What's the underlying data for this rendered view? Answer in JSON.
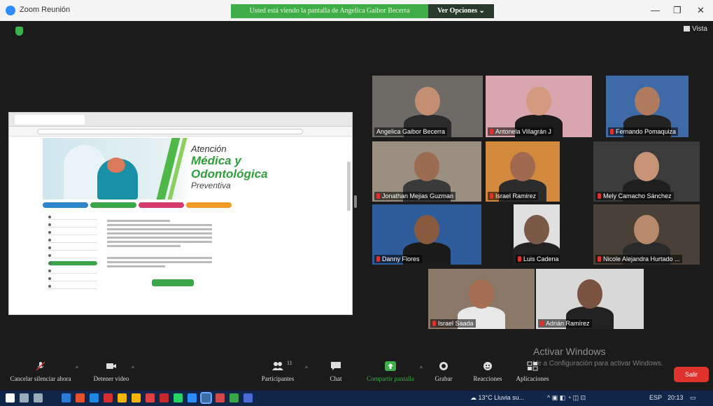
{
  "window": {
    "title": "Zoom Reunión",
    "share_banner": "Usted está viendo la pantalla de Angelica Gaibor Becerra",
    "view_options": "Ver Opciones ⌄",
    "minimize": "—",
    "maximize": "❐",
    "close": "✕",
    "vista": "Vista"
  },
  "shared_screen": {
    "banner_line1": "Atención",
    "banner_line2": "Médica y",
    "banner_line3": "Odontológica",
    "banner_line4": "Preventiva",
    "pill_colors": [
      "#2c86c9",
      "#3aa64a",
      "#d43b6a",
      "#f09a28"
    ]
  },
  "participants": [
    {
      "name": "Angelica Gaibor Becerra",
      "muted": false
    },
    {
      "name": "Antonela Villagrán J",
      "muted": true
    },
    {
      "name": "Fernando Pomaquiza",
      "muted": true
    },
    {
      "name": "Jonathan Mejias Guzman",
      "muted": true
    },
    {
      "name": "Israel Ramirez",
      "muted": true
    },
    {
      "name": "Mely Camacho Sánchez",
      "muted": true
    },
    {
      "name": "Danny Flores",
      "muted": true
    },
    {
      "name": "Luis Cadena",
      "muted": true
    },
    {
      "name": "Nicole Alejandra Hurtado ...",
      "muted": true
    },
    {
      "name": "Israel Saada",
      "muted": true
    },
    {
      "name": "Adrián Ramírez",
      "muted": true
    }
  ],
  "toolbar": {
    "mute_label": "Cancelar silenciar ahora",
    "video_label": "Detener video",
    "participants_label": "Participantes",
    "participants_count": "11",
    "chat_label": "Chat",
    "share_label": "Compartir pantalla",
    "record_label": "Grabar",
    "reactions_label": "Reacciones",
    "apps_label": "Aplicaciones",
    "leave_label": "Salir",
    "caret": "^"
  },
  "windows_watermark": {
    "title": "Activar Windows",
    "subtitle": "Ve a Configuración para activar Windows."
  },
  "taskbar": {
    "weather": "13°C Lluvia su...",
    "lang": "ESP",
    "time": "20:13"
  },
  "colors": {
    "accent_green": "#3fae49",
    "leave_red": "#e0322d",
    "active_speaker": "#c7e64b"
  }
}
